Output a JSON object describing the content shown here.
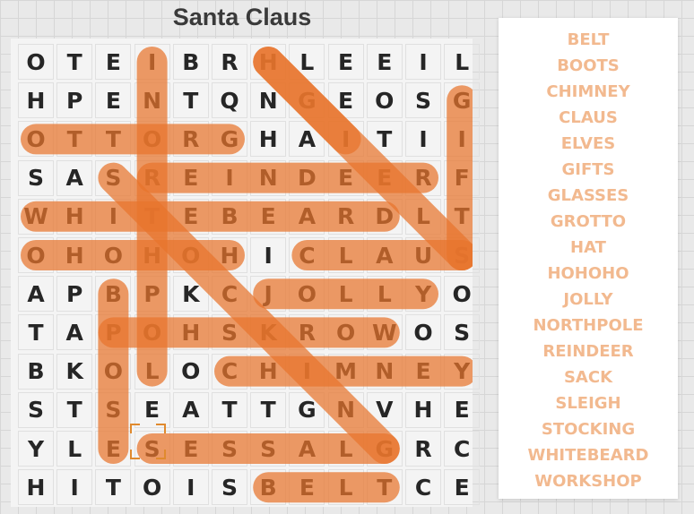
{
  "title": "Santa Claus",
  "grid": [
    "OTEIBRHLEEIL",
    "HPENTQNGEOSG",
    "OTTORGHAITII",
    "SASREINDEERF",
    "WHITEBEARDLT",
    "OHOHOHICLAUS",
    "APBPKCJOLLYO",
    "TAPOHSKROWOS",
    "BKOLOCHIMNEY",
    "STSEATTGNVHE",
    "YLESESSALGRC",
    "HITOISBELTCE"
  ],
  "found_words": [
    {
      "word": "HAT",
      "from": [
        0,
        6
      ],
      "to": [
        2,
        8
      ]
    },
    {
      "word": "GIFTS",
      "from": [
        1,
        11
      ],
      "to": [
        5,
        11
      ]
    },
    {
      "word": "GROTTO",
      "from": [
        2,
        5
      ],
      "to": [
        2,
        0
      ]
    },
    {
      "word": "REINDEER",
      "from": [
        3,
        3
      ],
      "to": [
        3,
        10
      ]
    },
    {
      "word": "WHITEBEARD",
      "from": [
        4,
        0
      ],
      "to": [
        4,
        9
      ]
    },
    {
      "word": "HOHOHO",
      "from": [
        5,
        5
      ],
      "to": [
        5,
        0
      ]
    },
    {
      "word": "CLAUS",
      "from": [
        5,
        7
      ],
      "to": [
        5,
        11
      ]
    },
    {
      "word": "JOLLY",
      "from": [
        6,
        6
      ],
      "to": [
        6,
        10
      ]
    },
    {
      "word": "WORKSHOP",
      "from": [
        7,
        9
      ],
      "to": [
        7,
        2
      ]
    },
    {
      "word": "CHIMNEY",
      "from": [
        8,
        5
      ],
      "to": [
        8,
        11
      ]
    },
    {
      "word": "GLASSES",
      "from": [
        10,
        9
      ],
      "to": [
        10,
        3
      ]
    },
    {
      "word": "BELT",
      "from": [
        11,
        6
      ],
      "to": [
        11,
        9
      ]
    },
    {
      "word": "SLEIGH",
      "from": [
        5,
        11
      ],
      "to": [
        0,
        6
      ]
    },
    {
      "word": "NORTHPOLE",
      "from": [
        0,
        3
      ],
      "to": [
        8,
        3
      ]
    },
    {
      "word": "STOCKING",
      "from": [
        3,
        2
      ],
      "to": [
        10,
        9
      ]
    },
    {
      "word": "BOOTS",
      "from": [
        6,
        2
      ],
      "to": [
        10,
        2
      ]
    }
  ],
  "selected_cell": [
    10,
    3
  ],
  "highlight_color": "#e8752d",
  "word_list": [
    "BELT",
    "BOOTS",
    "CHIMNEY",
    "CLAUS",
    "ELVES",
    "GIFTS",
    "GLASSES",
    "GROTTO",
    "HAT",
    "HOHOHO",
    "JOLLY",
    "NORTHPOLE",
    "REINDEER",
    "SACK",
    "SLEIGH",
    "STOCKING",
    "WHITEBEARD",
    "WORKSHOP"
  ]
}
